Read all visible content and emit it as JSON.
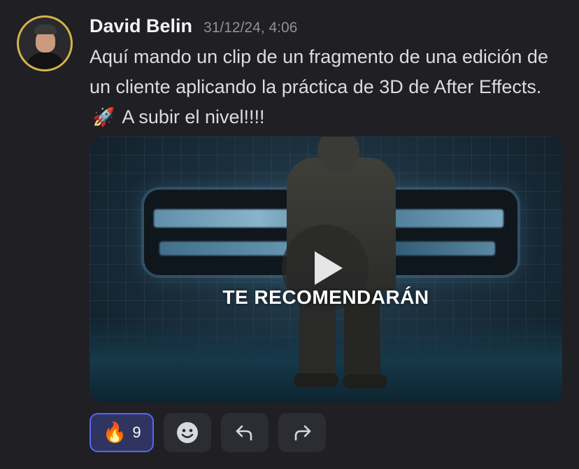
{
  "message": {
    "author": "David Belin",
    "timestamp": "31/12/24, 4:06",
    "text_before": "Aquí mando un clip de un fragmento de una edición de un cliente aplicando la práctica de 3D de After Effects.",
    "emoji": "🚀",
    "text_after": " A subir el nivel!!!!"
  },
  "video": {
    "caption": "TE RECOMENDARÁN"
  },
  "reactions": [
    {
      "emoji": "🔥",
      "count": "9",
      "selected": true
    }
  ],
  "actions": [
    {
      "icon": "add-reaction-icon"
    },
    {
      "icon": "reply-icon"
    },
    {
      "icon": "forward-icon"
    }
  ],
  "colors": {
    "background": "#1f1f24",
    "author": "#f2f3f5",
    "timestamp": "#8e9297",
    "reaction_selected_border": "#5865f2"
  }
}
